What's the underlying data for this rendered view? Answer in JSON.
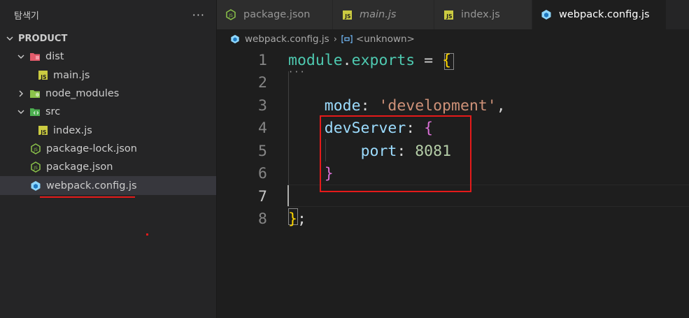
{
  "explorer": {
    "title": "탐색기",
    "more_icon": "ellipsis-icon",
    "root": "PRODUCT",
    "items": [
      {
        "label": "dist",
        "type": "folder",
        "icon": "folder-dist-icon"
      },
      {
        "label": "main.js",
        "type": "file",
        "icon": "js-file-icon"
      },
      {
        "label": "node_modules",
        "type": "folder",
        "icon": "folder-node-icon"
      },
      {
        "label": "src",
        "type": "folder",
        "icon": "folder-src-icon"
      },
      {
        "label": "index.js",
        "type": "file",
        "icon": "js-file-icon"
      },
      {
        "label": "package-lock.json",
        "type": "file",
        "icon": "node-file-icon"
      },
      {
        "label": "package.json",
        "type": "file",
        "icon": "node-file-icon"
      },
      {
        "label": "webpack.config.js",
        "type": "file",
        "icon": "webpack-file-icon",
        "selected": true
      }
    ]
  },
  "tabs": [
    {
      "label": "package.json",
      "icon": "node-file-icon"
    },
    {
      "label": "main.js",
      "icon": "js-file-icon",
      "italic": true
    },
    {
      "label": "index.js",
      "icon": "js-file-icon"
    },
    {
      "label": "webpack.config.js",
      "icon": "webpack-file-icon",
      "active": true,
      "unsaved": true
    }
  ],
  "breadcrumb": {
    "file": "webpack.config.js",
    "symbol": "<unknown>"
  },
  "editor": {
    "current_line": 7,
    "line_numbers": [
      "1",
      "2",
      "3",
      "4",
      "5",
      "6",
      "7",
      "8"
    ],
    "tokens": {
      "l1_module": "module",
      "l1_dot": ".",
      "l1_exports": "exports",
      "l1_eq": " = ",
      "l1_brace": "{",
      "l3_key": "mode",
      "l3_colon": ": ",
      "l3_val": "'development'",
      "l3_comma": ",",
      "l4_key": "devServer",
      "l4_colon": ": ",
      "l4_brace": "{",
      "l5_key": "port",
      "l5_colon": ": ",
      "l5_val": "8081",
      "l6_brace": "}",
      "l8_brace": "}",
      "l8_semi": ";"
    }
  },
  "colors": {
    "annotation_red": "#e51a1a",
    "js_badge": "#cbcb41",
    "node_green": "#8bc34a",
    "webpack_blue": "#8ed6fb"
  }
}
